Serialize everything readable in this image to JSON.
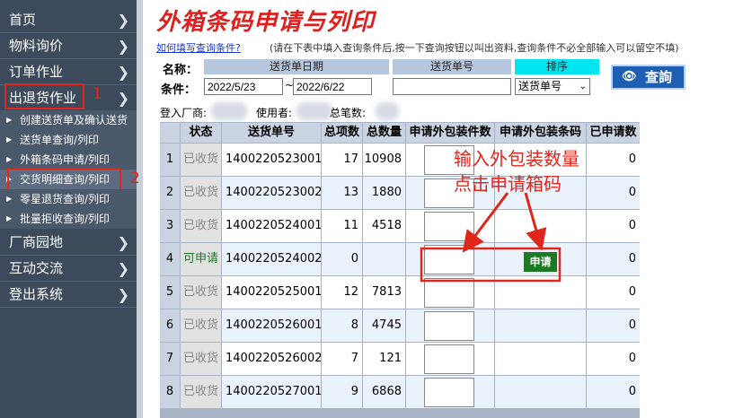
{
  "sidebar": {
    "items_top": [
      {
        "label": "首页"
      },
      {
        "label": "物料询价"
      },
      {
        "label": "订单作业"
      },
      {
        "label": "出退货作业"
      }
    ],
    "sub_items": [
      {
        "label": "创建送货单及确认送货"
      },
      {
        "label": "送货单查询/列印"
      },
      {
        "label": "外箱条码申请/列印"
      },
      {
        "label": "交货明细查询/列印"
      },
      {
        "label": "零星退货查询/列印"
      },
      {
        "label": "批量拒收查询/列印"
      }
    ],
    "items_bottom": [
      {
        "label": "厂商园地"
      },
      {
        "label": "互动交流"
      },
      {
        "label": "登出系统"
      }
    ],
    "annotation_1": "1",
    "annotation_2": "2"
  },
  "page": {
    "title": "外箱条码申请与列印",
    "help_link": "如何填写查询条件?",
    "help_hint": "(请在下表中填入查询条件后,按一下查询按钮以叫出资料,查询条件不必全部输入可以留空不填)"
  },
  "query": {
    "name_label": "名称：",
    "condition_label": "条件：",
    "col_date": "送货单日期",
    "col_no": "送货单号",
    "col_sort": "排序",
    "date_from": "2022/5/23",
    "date_sep": "~",
    "date_to": "2022/6/22",
    "delivery_no": "",
    "sort_value": "送货单号",
    "button_label": "查詢",
    "button_icon": "binoculars-icon"
  },
  "info": {
    "vendor_label": "登入厂商:",
    "user_label": "使用者:",
    "total_label": "总笔数:"
  },
  "table": {
    "headers": [
      "状态",
      "送货单号",
      "总项数",
      "总数量",
      "申请外包装件数",
      "申请外包装条码",
      "已申请数"
    ],
    "rows": [
      {
        "idx": "1",
        "status": "已收货",
        "no": "1400220523001",
        "items": "17",
        "qty": "10908",
        "applied": "0"
      },
      {
        "idx": "2",
        "status": "已收货",
        "no": "1400220523002",
        "items": "13",
        "qty": "1880",
        "applied": "0"
      },
      {
        "idx": "3",
        "status": "已收货",
        "no": "1400220524001",
        "items": "11",
        "qty": "4518",
        "applied": "0"
      },
      {
        "idx": "4",
        "status": "可申请",
        "no": "1400220524002",
        "items": "0",
        "qty": "",
        "applied": "0"
      },
      {
        "idx": "5",
        "status": "已收货",
        "no": "1400220525001",
        "items": "12",
        "qty": "7813",
        "applied": "0"
      },
      {
        "idx": "6",
        "status": "已收货",
        "no": "1400220526001",
        "items": "8",
        "qty": "4745",
        "applied": "0"
      },
      {
        "idx": "7",
        "status": "已收货",
        "no": "1400220526002",
        "items": "7",
        "qty": "121",
        "applied": "0"
      },
      {
        "idx": "8",
        "status": "已收货",
        "no": "1400220527001",
        "items": "9",
        "qty": "6868",
        "applied": "0"
      }
    ],
    "apply_button": "申请"
  },
  "annotation": {
    "line1": "输入外包装数量",
    "line2": "点击申请箱码"
  },
  "colors": {
    "sidebar_bg": "#3c4a5c",
    "title_red": "#e01e1e",
    "annotation_red": "#e0251b",
    "apply_green": "#1b7a24",
    "query_blue": "#1f5fb3",
    "sort_cyan": "#00e5f0",
    "header_bg": "#b7c7dd"
  }
}
